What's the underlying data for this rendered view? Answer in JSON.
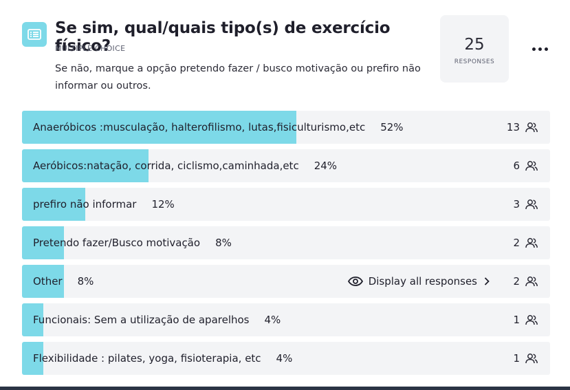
{
  "question": {
    "title": "Se sim, qual/quais tipo(s) de exercício físico?",
    "type_label": "MULTIPLE CHOICE",
    "description": "Se não, marque a opção pretendo fazer / busco motivação ou prefiro não informar ou outros.",
    "icon": "multiple-choice-icon"
  },
  "responses": {
    "count": "25",
    "label": "RESPONSES"
  },
  "menu_icon": "more-dots-icon",
  "accent_color": "#7dd9e8",
  "options": [
    {
      "label": "Anaeróbicos :musculação, halterofilismo, lutas,fisiculturismo,etc",
      "percent_label": "52%",
      "percent": 52,
      "count": "13"
    },
    {
      "label": "Aeróbicos:natação, corrida, ciclismo,caminhada,etc",
      "percent_label": "24%",
      "percent": 24,
      "count": "6"
    },
    {
      "label": "prefiro não informar",
      "percent_label": "12%",
      "percent": 12,
      "count": "3"
    },
    {
      "label": "Pretendo fazer/Busco motivação",
      "percent_label": "8%",
      "percent": 8,
      "count": "2"
    },
    {
      "label": "Other",
      "percent_label": "8%",
      "percent": 8,
      "count": "2",
      "action_label": "Display all responses"
    },
    {
      "label": "Funcionais: Sem a utilização de aparelhos",
      "percent_label": "4%",
      "percent": 4,
      "count": "1"
    },
    {
      "label": "Flexibilidade : pilates, yoga, fisioterapia, etc",
      "percent_label": "4%",
      "percent": 4,
      "count": "1"
    }
  ]
}
